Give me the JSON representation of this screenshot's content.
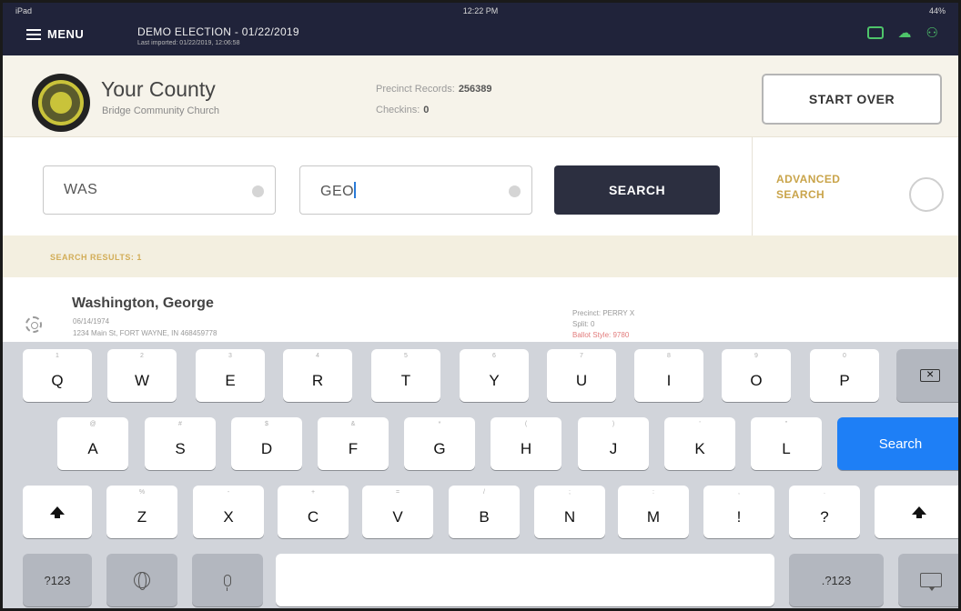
{
  "status_bar": {
    "carrier": "iPad",
    "time": "12:22 PM",
    "battery": "44%"
  },
  "nav": {
    "menu_label": "MENU",
    "election_title": "DEMO ELECTION - 01/22/2019",
    "election_subtitle": "Last imported: 01/22/2019, 12:06:58",
    "icons": [
      "printer-icon",
      "cloud-icon",
      "people-icon"
    ]
  },
  "county": {
    "name": "Your County",
    "site": "Bridge Community Church",
    "precinct_records_label": "Precinct Records:",
    "precinct_records_value": "256389",
    "checkins_label": "Checkins:",
    "checkins_value": "0",
    "start_over_label": "START OVER"
  },
  "search": {
    "last_name_value": "WAS",
    "first_name_value": "GEO",
    "button_label": "SEARCH",
    "advanced_label_line1": "ADVANCED",
    "advanced_label_line2": "SEARCH"
  },
  "results": {
    "label": "SEARCH RESULTS: 1",
    "items": [
      {
        "name": "Washington, George",
        "dob": "06/14/1974",
        "address": "1234 Main St, FORT WAYNE, IN 468459778",
        "precinct": "Precinct: PERRY X",
        "split": "Split: 0",
        "ballot_style": "Ballot Style: 9780"
      }
    ]
  },
  "keyboard": {
    "row1": [
      {
        "k": "Q",
        "h": "1"
      },
      {
        "k": "W",
        "h": "2"
      },
      {
        "k": "E",
        "h": "3"
      },
      {
        "k": "R",
        "h": "4"
      },
      {
        "k": "T",
        "h": "5"
      },
      {
        "k": "Y",
        "h": "6"
      },
      {
        "k": "U",
        "h": "7"
      },
      {
        "k": "I",
        "h": "8"
      },
      {
        "k": "O",
        "h": "9"
      },
      {
        "k": "P",
        "h": "0"
      }
    ],
    "row2": [
      {
        "k": "A",
        "h": "@"
      },
      {
        "k": "S",
        "h": "#"
      },
      {
        "k": "D",
        "h": "$"
      },
      {
        "k": "F",
        "h": "&"
      },
      {
        "k": "G",
        "h": "*"
      },
      {
        "k": "H",
        "h": "("
      },
      {
        "k": "J",
        "h": ")"
      },
      {
        "k": "K",
        "h": "'"
      },
      {
        "k": "L",
        "h": "\""
      }
    ],
    "row3": [
      {
        "k": "Z",
        "h": "%"
      },
      {
        "k": "X",
        "h": "-"
      },
      {
        "k": "C",
        "h": "+"
      },
      {
        "k": "V",
        "h": "="
      },
      {
        "k": "B",
        "h": "/"
      },
      {
        "k": "N",
        "h": ";"
      },
      {
        "k": "M",
        "h": ":"
      },
      {
        "k": "!",
        "h": ","
      },
      {
        "k": "?",
        "h": "."
      }
    ],
    "search_key_label": "Search",
    "numbers_key_label": ".?123"
  },
  "colors": {
    "nav_bg": "#20233a",
    "nav_icon": "#4ec46a",
    "accent_gold": "#c9a44a",
    "search_button": "#2c2f40",
    "keyboard_blue": "#1e7ff6"
  }
}
